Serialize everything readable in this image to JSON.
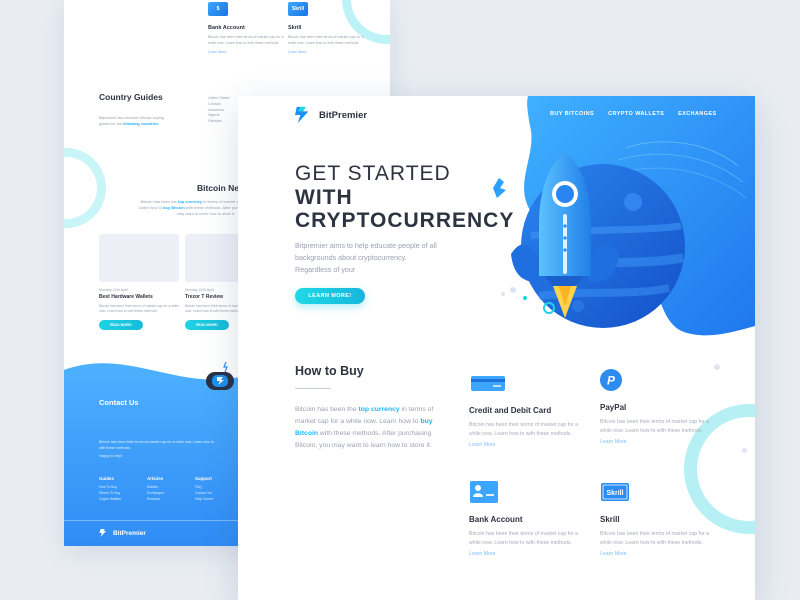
{
  "brand": {
    "name": "BitPremier",
    "accent": "#1fd3e4",
    "blue": "#2f8cf5"
  },
  "front": {
    "nav": [
      "BUY BITCOINS",
      "CRYPTO WALLETS",
      "EXCHANGES"
    ],
    "hero": {
      "line1": "GET STARTED",
      "line2": "WITH",
      "line3": "CRYPTOCURRENCY",
      "paragraph": "Bitpremier aims to help educate people of all backgrounds about cryptocurrency. Regardless of your",
      "cta": "LEARN MORE!"
    },
    "how": {
      "title": "How to Buy",
      "p1": "Bitcoin has been the ",
      "hl1": "top currency",
      "p2": " in terms of market cap for a while now. Learn how to ",
      "hl2": "buy Bitcoin",
      "p3": " with these methods. After purchasing Bitcoin, you may want to learn how to store it."
    },
    "methods": [
      {
        "title": "Credit and Debit Card",
        "text": "Bitcoin has been their terms of market cap for a while now. Learn how to with these methods.",
        "link": "Learn More",
        "icon": "credit-card-icon"
      },
      {
        "title": "PayPal",
        "text": "Bitcoin has been their terms of market cap for a while now. Learn how to with these methods.",
        "link": "Learn More",
        "icon": "paypal-icon"
      },
      {
        "title": "Bank Account",
        "text": "Bitcoin has been their terms of market cap for a while now. Learn how to with these methods.",
        "link": "Learn More",
        "icon": "bank-account-icon"
      },
      {
        "title": "Skrill",
        "text": "Bitcoin has been their terms of market cap for a while now. Learn how to with these methods.",
        "link": "Learn More",
        "icon": "skrill-icon"
      }
    ]
  },
  "back": {
    "payments": [
      {
        "title": "Bank Account",
        "text": "Bitcoin has been their terms of market cap for a while now. Learn how to with these methods.",
        "link": "Learn More"
      },
      {
        "title": "Skrill",
        "text": "Bitcoin has been their terms of market cap for a while now. Learn how to with these methods.",
        "link": "Learn More"
      }
    ],
    "country_guides": {
      "title": "Country Guides",
      "text": "Bitpremier also features Bitcoin buying guides for the ",
      "hl": "following countries:",
      "countries": [
        "United States",
        "Canada",
        "Indonesia",
        "Nigeria",
        "Pakistan"
      ]
    },
    "news": {
      "title": "Bitcoin Ne",
      "t1": "Bitcoin has been the ",
      "hl1": "top currency",
      "t2": " in terms of market cap for a while now. Learn how to ",
      "hl2": "buy Bitcoin",
      "t3": " with these methods. After purchasing Bitcoin, you may want to learn how to store it.",
      "cards": [
        {
          "date": "Monday 22th April",
          "title": "Best Hardware Wallets",
          "text": "Bitcoin has been their terms of market cap for a while now. Learn how to with these methods.",
          "button": "READ MORE!"
        },
        {
          "date": "Monday 22th April",
          "title": "Trezor T Review",
          "text": "Bitcoin has been their terms of market cap for a while now. Learn how to with these methods.",
          "button": "READ MORE!"
        }
      ]
    },
    "contact": {
      "title": "Contact Us",
      "text": "Bitcoin has been their terms of market cap for a while now. Learn how to with these methods.",
      "help": "Happy to help!"
    },
    "footer_cols": [
      {
        "heading": "Guides",
        "items": [
          "How To Buy",
          "Where To Buy",
          "Crypto Wallets"
        ]
      },
      {
        "heading": "Articles",
        "items": [
          "Wallets",
          "Exchanges",
          "Reviews"
        ]
      },
      {
        "heading": "Support",
        "items": [
          "FAQ",
          "Contact Us",
          "Help Center"
        ]
      }
    ],
    "footer_logo": "BitPremier"
  }
}
